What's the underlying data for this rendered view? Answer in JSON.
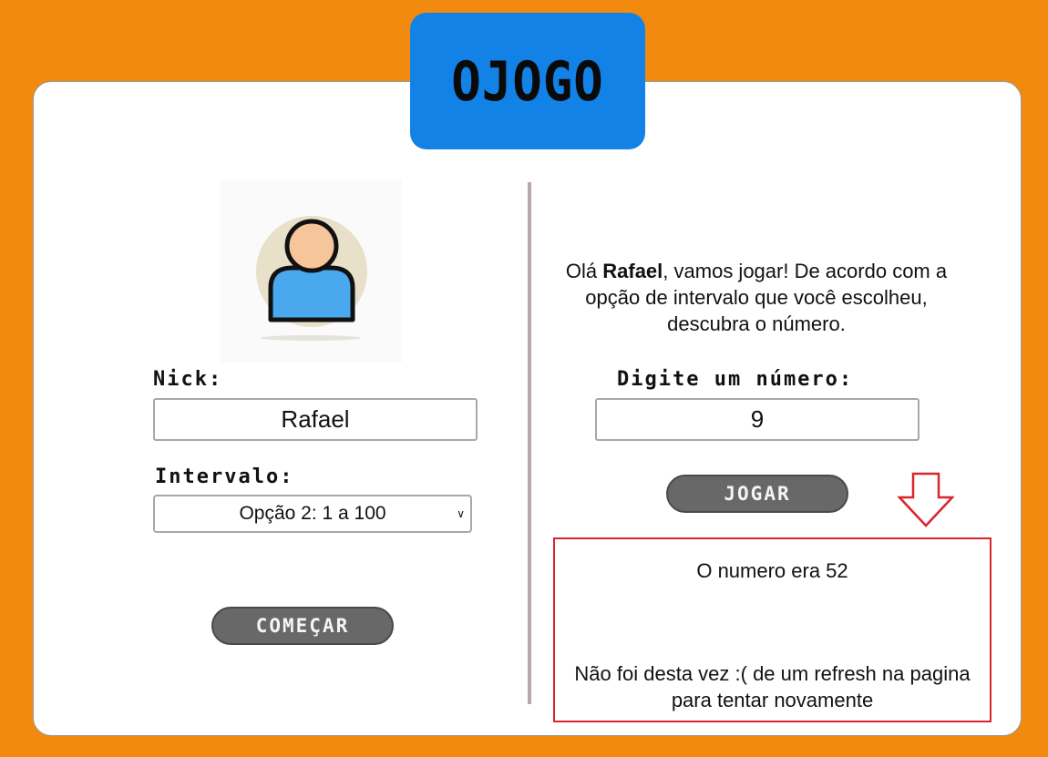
{
  "header": {
    "title": "OJOGO"
  },
  "left_panel": {
    "nick_label": "Nick:",
    "nick_value": "Rafael",
    "interval_label": "Intervalo:",
    "interval_selected": "Opção 2: 1 a 100",
    "start_button": "COMEÇAR"
  },
  "right_panel": {
    "greeting_prefix": "Olá ",
    "greeting_name": "Rafael",
    "greeting_suffix": ", vamos jogar! De acordo com a opção de intervalo que você escolheu, descubra o número.",
    "number_label": "Digite um número:",
    "number_value": "9",
    "play_button": "JOGAR",
    "result_number_text": "O numero era 52",
    "result_message": "Não foi desta vez :( de um refresh na pagina para tentar novamente"
  },
  "colors": {
    "background": "#f28a0f",
    "title_box": "#1282e6",
    "button": "#686868",
    "result_border": "#d8262c"
  }
}
